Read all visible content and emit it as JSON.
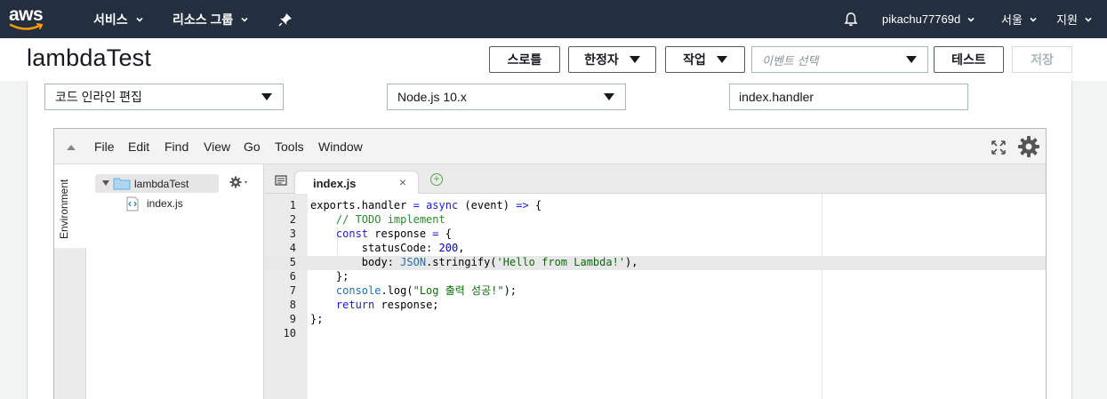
{
  "topnav": {
    "logo_text": "aws",
    "services": "서비스",
    "resource_groups": "리소스 그룹",
    "username": "pikachu77769d",
    "region": "서울",
    "support": "지원"
  },
  "header": {
    "function_name": "lambdaTest",
    "throttle": "스로틀",
    "qualifiers": "한정자",
    "actions": "작업",
    "event_placeholder": "이벤트 선택",
    "test": "테스트",
    "save": "저장"
  },
  "config": {
    "code_entry": "코드 인라인 편집",
    "runtime": "Node.js 10.x",
    "handler": "index.handler"
  },
  "ide": {
    "menu": [
      "File",
      "Edit",
      "Find",
      "View",
      "Go",
      "Tools",
      "Window"
    ],
    "env_label": "Environment",
    "tree_root": "lambdaTest",
    "tree_file": "index.js",
    "tab_label": "index.js",
    "tab_close": "×",
    "tab_add": "+",
    "line_numbers": [
      "1",
      "2",
      "3",
      "4",
      "5",
      "6",
      "7",
      "8",
      "9",
      "10"
    ],
    "code": [
      "exports.handler = async (event) => {",
      "    // TODO implement",
      "    const response = {",
      "        statusCode: 200,",
      "        body: JSON.stringify('Hello from Lambda!'),",
      "    };",
      "    console.log(\"Log 출력 성공!\");",
      "    return response;",
      "};",
      ""
    ]
  },
  "icons": {
    "bell": "bell-icon",
    "pin": "pin-icon",
    "expand": "fullscreen-icon",
    "settings": "gear-icon",
    "folder": "folder-icon",
    "file": "js-file-icon"
  },
  "colors": {
    "nav_bg": "#232f3e",
    "aws_orange": "#ff9900",
    "keyword": "#1c1cd8",
    "comment": "#2d8a2d",
    "string": "#0a6d0a"
  }
}
